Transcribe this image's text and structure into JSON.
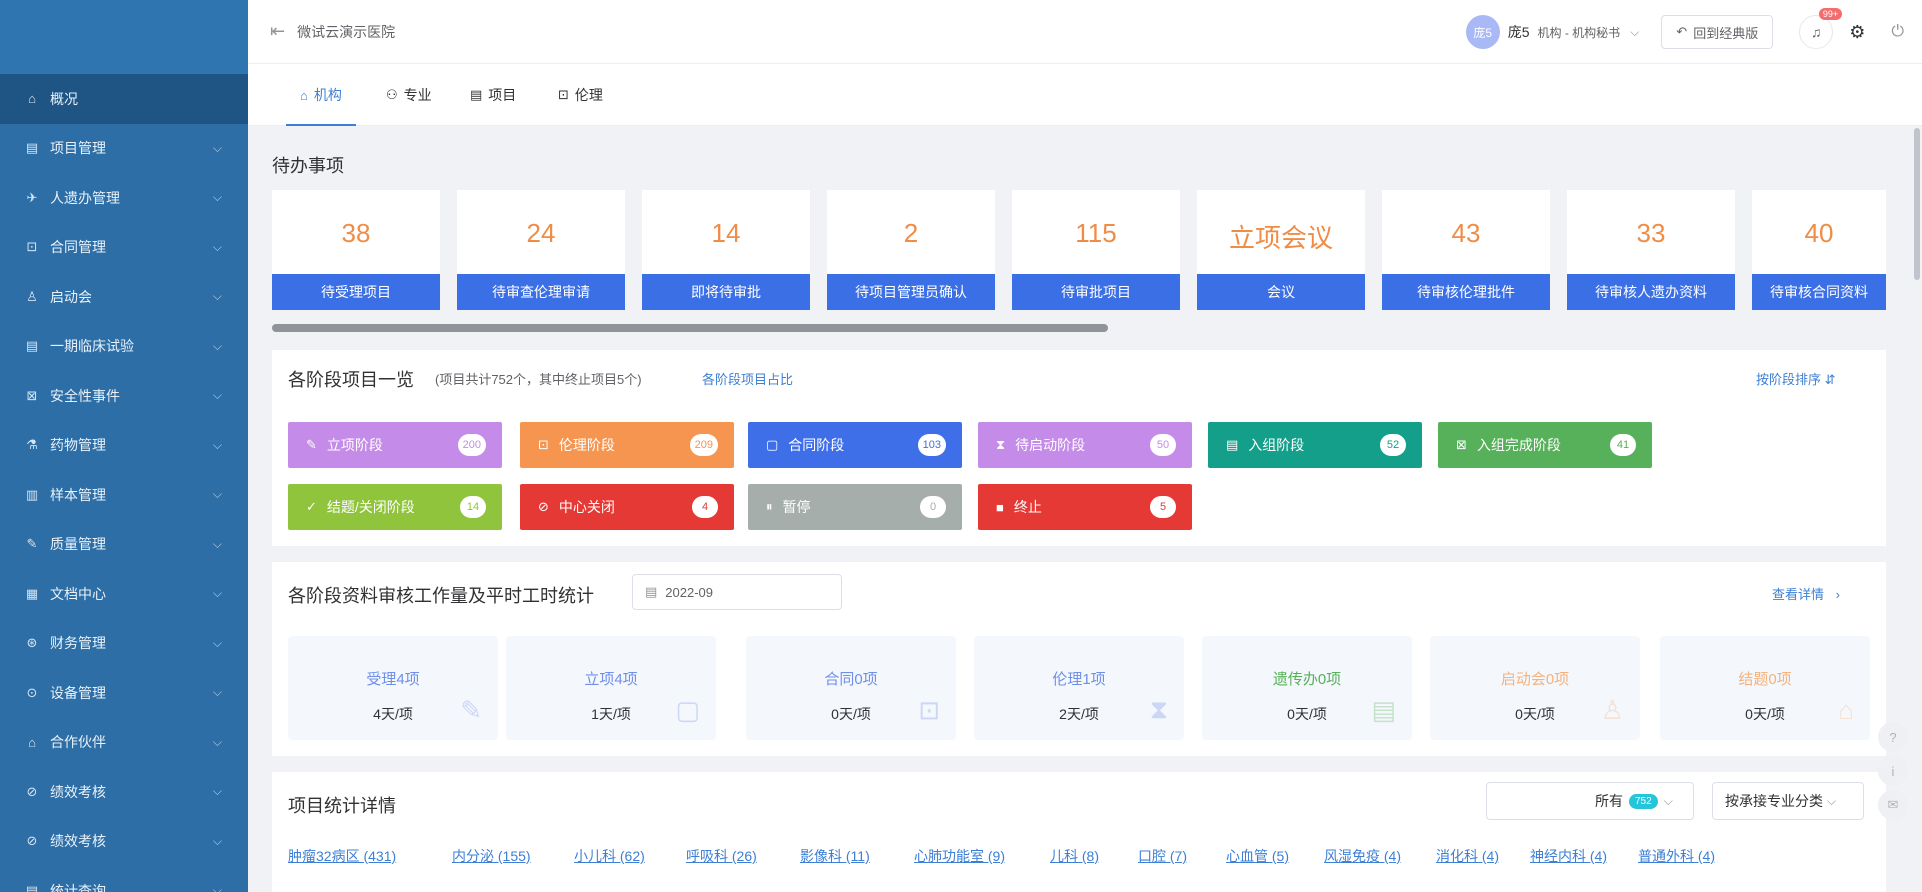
{
  "sidebar": {
    "items": [
      {
        "label": "概况",
        "icon": "⌂",
        "has_children": false,
        "active": true
      },
      {
        "label": "项目管理",
        "icon": "▤",
        "has_children": true
      },
      {
        "label": "人遗办管理",
        "icon": "✈",
        "has_children": true
      },
      {
        "label": "合同管理",
        "icon": "⊡",
        "has_children": true
      },
      {
        "label": "启动会",
        "icon": "♙",
        "has_children": true
      },
      {
        "label": "一期临床试验",
        "icon": "▤",
        "has_children": true
      },
      {
        "label": "安全性事件",
        "icon": "⊠",
        "has_children": true
      },
      {
        "label": "药物管理",
        "icon": "⚗",
        "has_children": true
      },
      {
        "label": "样本管理",
        "icon": "▥",
        "has_children": true
      },
      {
        "label": "质量管理",
        "icon": "✎",
        "has_children": true
      },
      {
        "label": "文档中心",
        "icon": "▦",
        "has_children": true
      },
      {
        "label": "财务管理",
        "icon": "⊛",
        "has_children": true
      },
      {
        "label": "设备管理",
        "icon": "⊙",
        "has_children": true
      },
      {
        "label": "合作伙伴",
        "icon": "⌂",
        "has_children": true
      },
      {
        "label": "绩效考核",
        "icon": "⊘",
        "has_children": true
      },
      {
        "label": "绩效考核",
        "icon": "⊘",
        "has_children": true
      },
      {
        "label": "统计查询",
        "icon": "▤",
        "has_children": true
      }
    ]
  },
  "topbar": {
    "org_name": "微试云演示医院",
    "avatar_text": "庞5",
    "user_name": "庞5",
    "user_role": "机构 - 机构秘书",
    "old_version_label": "回到经典版",
    "notification_count": "99+"
  },
  "tabs": [
    {
      "label": "机构",
      "icon": "⌂",
      "active": true
    },
    {
      "label": "专业",
      "icon": "⚇",
      "active": false
    },
    {
      "label": "项目",
      "icon": "▤",
      "active": false
    },
    {
      "label": "伦理",
      "icon": "⊡",
      "active": false
    }
  ],
  "todo": {
    "title": "待办事项",
    "cards": [
      {
        "value": "38",
        "label": "待受理项目"
      },
      {
        "value": "24",
        "label": "待审查伦理审请"
      },
      {
        "value": "14",
        "label": "即将待审批"
      },
      {
        "value": "2",
        "label": "待项目管理员确认"
      },
      {
        "value": "115",
        "label": "待审批项目"
      },
      {
        "value": "立项会议",
        "label": "会议"
      },
      {
        "value": "43",
        "label": "待审核伦理批件"
      },
      {
        "value": "33",
        "label": "待审核人遗办资料"
      },
      {
        "value": "40",
        "label": "待审核合同资料"
      }
    ]
  },
  "stages": {
    "title": "各阶段项目一览",
    "subtitle": "(项目共计752个，其中终止项目5个)",
    "link": "各阶段项目占比",
    "sort_link": "按阶段排序 ⇵",
    "items": [
      {
        "label": "立项阶段",
        "count": "200",
        "color": "#c48ce8",
        "icon": "✎"
      },
      {
        "label": "伦理阶段",
        "count": "209",
        "color": "#f5954f",
        "icon": "⊡"
      },
      {
        "label": "合同阶段",
        "count": "103",
        "color": "#3f6fe8",
        "icon": "▢"
      },
      {
        "label": "待启动阶段",
        "count": "50",
        "color": "#c48ce8",
        "icon": "⧗"
      },
      {
        "label": "入组阶段",
        "count": "52",
        "color": "#149f8a",
        "icon": "▤"
      },
      {
        "label": "入组完成阶段",
        "count": "41",
        "color": "#57b05a",
        "icon": "⊠"
      },
      {
        "label": "结题/关闭阶段",
        "count": "14",
        "color": "#8fc43c",
        "icon": "✓"
      },
      {
        "label": "中心关闭",
        "count": "4",
        "color": "#e53935",
        "icon": "⊘"
      },
      {
        "label": "暂停",
        "count": "0",
        "color": "#a5aeaa",
        "icon": "⏸"
      },
      {
        "label": "终止",
        "count": "5",
        "color": "#e53935",
        "icon": "■"
      }
    ]
  },
  "workload": {
    "title": "各阶段资料审核工作量及平时工时统计",
    "date": "2022-09",
    "detail_link": "查看详情",
    "cards": [
      {
        "title": "受理4项",
        "value": "4天/项",
        "color": "#6f8fe8",
        "icon": "✎"
      },
      {
        "title": "立项4项",
        "value": "1天/项",
        "color": "#6f8fe8",
        "icon": "▢"
      },
      {
        "title": "合同0项",
        "value": "0天/项",
        "color": "#6f8fe8",
        "icon": "⊡"
      },
      {
        "title": "伦理1项",
        "value": "2天/项",
        "color": "#6f8fe8",
        "icon": "⧗"
      },
      {
        "title": "遗传办0项",
        "value": "0天/项",
        "color": "#57b05a",
        "icon": "▤"
      },
      {
        "title": "启动会0项",
        "value": "0天/项",
        "color": "#f5b27a",
        "icon": "♙"
      },
      {
        "title": "结题0项",
        "value": "0天/项",
        "color": "#f5b27a",
        "icon": "⌂"
      }
    ]
  },
  "project_stats": {
    "title": "项目统计详情",
    "filter_label": "所有",
    "filter_count": "752",
    "sort_label": "按承接专业分类",
    "departments": [
      "肿瘤32病区 (431)",
      "内分泌 (155)",
      "小儿科 (62)",
      "呼吸科 (26)",
      "影像科 (11)",
      "心肺功能室 (9)",
      "儿科 (8)",
      "口腔 (7)",
      "心血管 (5)",
      "风湿免疫 (4)",
      "消化科 (4)",
      "神经内科 (4)",
      "普通外科 (4)"
    ]
  }
}
